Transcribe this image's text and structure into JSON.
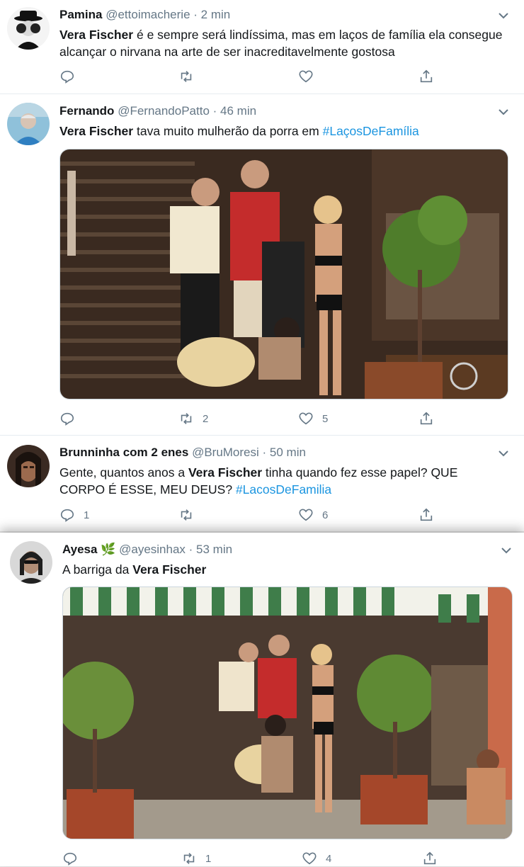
{
  "tweets": [
    {
      "name": "Pamina",
      "handle": "@ettoimacherie",
      "time": "· 2 min",
      "text_bold": "Vera Fischer",
      "text_rest": " é e sempre será lindíssima, mas em laços de família ela consegue alcançar o nirvana na arte de ser inacreditavelmente gostosa",
      "counts": {
        "reply": "",
        "retweet": "",
        "like": ""
      }
    },
    {
      "name": "Fernando",
      "handle": "@FernandoPatto",
      "time": "· 46 min",
      "text_bold": "Vera Fischer",
      "text_rest": " tava muito mulherão da porra em ",
      "hashtag": "#LaçosDeFamília",
      "counts": {
        "reply": "",
        "retweet": "2",
        "like": "5"
      }
    },
    {
      "name": "Brunninha com 2 enes",
      "handle": "@BruMoresi",
      "time": "· 50 min",
      "text_pre": "Gente, quantos anos a ",
      "text_bold": "Vera Fischer",
      "text_rest": " tinha quando fez esse papel? QUE CORPO É ESSE, MEU DEUS? ",
      "hashtag": "#LacosDeFamilia",
      "counts": {
        "reply": "1",
        "retweet": "",
        "like": "6"
      }
    },
    {
      "name": "Ayesa",
      "name_emoji": "🌿",
      "handle": "@ayesinhax",
      "time": "· 53 min",
      "text_pre": "A barriga da ",
      "text_bold": "Vera Fischer",
      "counts": {
        "reply": "",
        "retweet": "1",
        "like": "4"
      }
    }
  ],
  "icons": [
    "reply-icon",
    "retweet-icon",
    "like-icon",
    "share-icon",
    "chevron-down-icon"
  ],
  "colors": {
    "link": "#1b95e0",
    "secondary": "#657786",
    "text": "#14171a"
  }
}
